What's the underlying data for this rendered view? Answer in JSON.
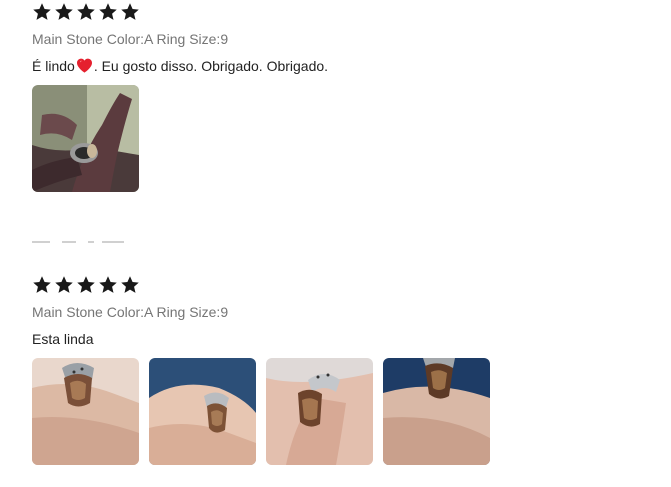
{
  "reviews": [
    {
      "rating": 5,
      "sku": "Main Stone Color:A Ring Size:9",
      "text_before": "É lindo",
      "text_after": ". Eu gosto disso. Obrigado. Obrigado.",
      "emoji": "red-heart-icon",
      "photo_count": 1
    },
    {
      "rating": 5,
      "sku": "Main Stone Color:A Ring Size:9",
      "text": "Esta linda",
      "photo_count": 4
    }
  ],
  "colors": {
    "star": "#191919",
    "heart": "#e5202e",
    "sku_text": "#757575"
  }
}
